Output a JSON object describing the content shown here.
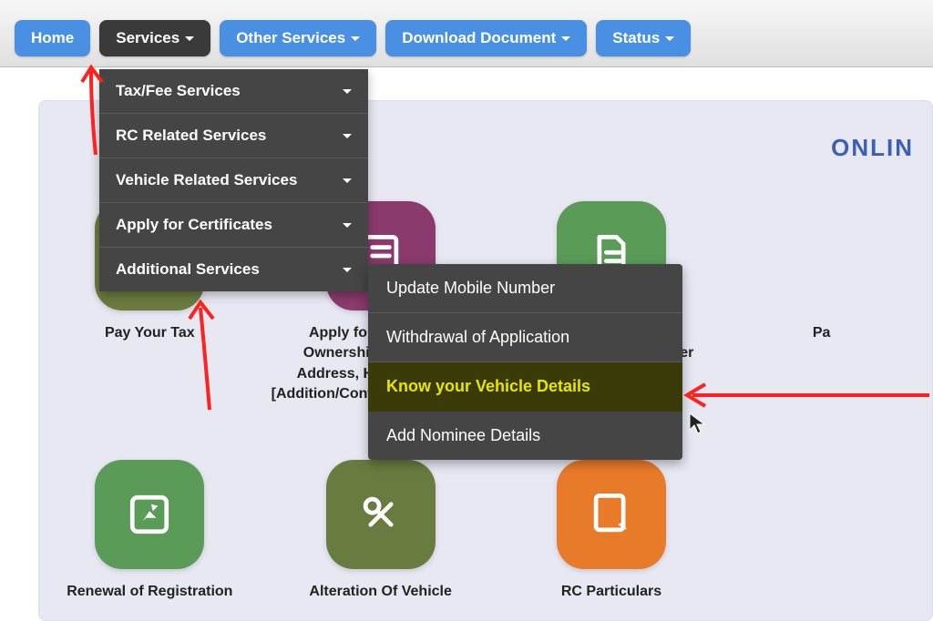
{
  "nav": {
    "home": "Home",
    "services": "Services",
    "other_services": "Other Services",
    "download_document": "Download Document",
    "status": "Status"
  },
  "dropdown1": {
    "tax_fee": "Tax/Fee Services",
    "rc_related": "RC Related Services",
    "vehicle_related": "Vehicle Related Services",
    "apply_cert": "Apply for Certificates",
    "additional": "Additional Services"
  },
  "dropdown2": {
    "update_mobile": "Update Mobile Number",
    "withdrawal": "Withdrawal of Application",
    "know_vehicle": "Know your Vehicle Details",
    "add_nominee": "Add Nominee Details"
  },
  "panel_title": "ONLIN",
  "tiles": {
    "pay_tax": "Pay Your Tax",
    "apply_transfer": "Apply for Transfer of Ownership, Change of Address, Hypothecation [Addition/Continuation/Termination]",
    "fitness": "Apply for Fitness Renewal/Re-Apply After Fitness Being Failed",
    "partial": "Pa",
    "renewal": "Renewal of Registration",
    "alteration": "Alteration Of Vehicle",
    "rc_particulars": "RC Particulars"
  }
}
